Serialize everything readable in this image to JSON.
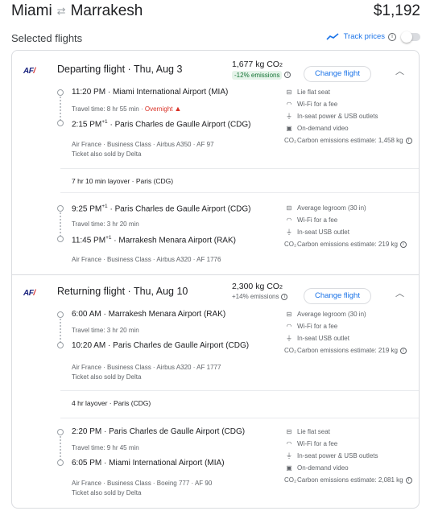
{
  "header": {
    "origin": "Miami",
    "destination": "Marrakesh",
    "price": "$1,192"
  },
  "selected_title": "Selected flights",
  "track_prices_label": "Track prices",
  "change_flight_label": "Change flight",
  "departing": {
    "title": "Departing flight · Thu, Aug 3",
    "co2": "1,677 kg CO",
    "co2_badge": "-12% emissions",
    "seg1": {
      "dep_time": "11:20 PM",
      "dep_airport": "Miami International Airport (MIA)",
      "travel_time": "Travel time: 8 hr 55 min",
      "overnight": "Overnight",
      "arr_time": "2:15 PM",
      "arr_sup": "+1",
      "arr_airport": "Paris Charles de Gaulle Airport (CDG)",
      "meta": "Air France · Business Class · Airbus A350 · AF 97",
      "sold_by": "Ticket also sold by Delta",
      "amenities": [
        "Lie flat seat",
        "Wi-Fi for a fee",
        "In-seat power & USB outlets",
        "On-demand video",
        "Carbon emissions estimate: 1,458 kg"
      ]
    },
    "layover": "7 hr 10 min layover · Paris (CDG)",
    "seg2": {
      "dep_time": "9:25 PM",
      "dep_sup": "+1",
      "dep_airport": "Paris Charles de Gaulle Airport (CDG)",
      "travel_time": "Travel time: 3 hr 20 min",
      "arr_time": "11:45 PM",
      "arr_sup": "+1",
      "arr_airport": "Marrakesh Menara Airport (RAK)",
      "meta": "Air France · Business Class · Airbus A320 · AF 1776",
      "amenities": [
        "Average legroom (30 in)",
        "Wi-Fi for a fee",
        "In-seat USB outlet",
        "Carbon emissions estimate: 219 kg"
      ]
    }
  },
  "returning": {
    "title": "Returning flight · Thu, Aug 10",
    "co2": "2,300 kg CO",
    "co2_sub": "+14% emissions",
    "seg1": {
      "dep_time": "6:00 AM",
      "dep_airport": "Marrakesh Menara Airport (RAK)",
      "travel_time": "Travel time: 3 hr 20 min",
      "arr_time": "10:20 AM",
      "arr_airport": "Paris Charles de Gaulle Airport (CDG)",
      "meta": "Air France · Business Class · Airbus A320 · AF 1777",
      "sold_by": "Ticket also sold by Delta",
      "amenities": [
        "Average legroom (30 in)",
        "Wi-Fi for a fee",
        "In-seat USB outlet",
        "Carbon emissions estimate: 219 kg"
      ]
    },
    "layover": "4 hr layover · Paris (CDG)",
    "seg2": {
      "dep_time": "2:20 PM",
      "dep_airport": "Paris Charles de Gaulle Airport (CDG)",
      "travel_time": "Travel time: 9 hr 45 min",
      "arr_time": "6:05 PM",
      "arr_airport": "Miami International Airport (MIA)",
      "meta": "Air France · Business Class · Boeing 777 · AF 90",
      "sold_by": "Ticket also sold by Delta",
      "amenities": [
        "Lie flat seat",
        "Wi-Fi for a fee",
        "In-seat power & USB outlets",
        "On-demand video",
        "Carbon emissions estimate: 2,081 kg"
      ]
    }
  },
  "icons": {
    "airline_logo": "AF",
    "swap": "swap-arrows-icon",
    "trend": "trend-line-icon",
    "chevron": "chevron-up-icon"
  },
  "colors": {
    "accent": "#1a73e8",
    "warning": "#d93025",
    "green_badge": "#137333"
  }
}
